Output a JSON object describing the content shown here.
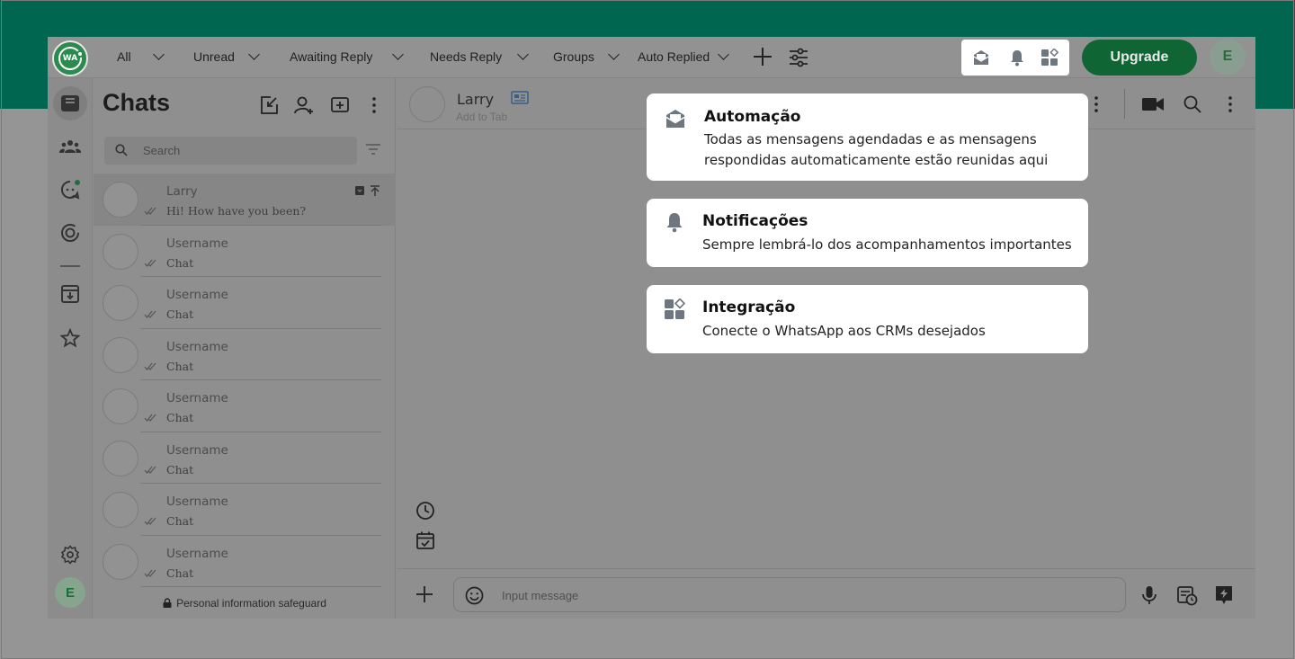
{
  "filter_tabs": [
    {
      "label": "All"
    },
    {
      "label": "Unread"
    },
    {
      "label": "Awaiting Reply"
    },
    {
      "label": "Needs Reply"
    },
    {
      "label": "Groups"
    },
    {
      "label": "Auto Replied"
    }
  ],
  "logo": {
    "text": "WA"
  },
  "upgrade_label": "Upgrade",
  "user_initial": "E",
  "chats": {
    "title": "Chats",
    "search_placeholder": "Search",
    "items": [
      {
        "name": "Larry",
        "message": "Hi! How have you been?"
      },
      {
        "name": "Username",
        "message": "Chat"
      },
      {
        "name": "Username",
        "message": "Chat"
      },
      {
        "name": "Username",
        "message": "Chat"
      },
      {
        "name": "Username",
        "message": "Chat"
      },
      {
        "name": "Username",
        "message": "Chat"
      },
      {
        "name": "Username",
        "message": "Chat"
      },
      {
        "name": "Username",
        "message": "Chat"
      }
    ],
    "safeguard_text": "Personal information safeguard"
  },
  "conversation": {
    "name": "Larry",
    "sub": "Add to Tab",
    "input_placeholder": "Input message"
  },
  "tooltips": [
    {
      "icon": "automation-inbox-icon",
      "title": "Automação",
      "description": "Todas as mensagens agendadas e as mensagens respondidas automaticamente estão reunidas aqui"
    },
    {
      "icon": "bell-icon",
      "title": "Notificações",
      "description": "Sempre lembrá-lo dos acompanhamentos importantes"
    },
    {
      "icon": "integration-icon",
      "title": "Integração",
      "description": "Conecte o WhatsApp aos CRMs desejados"
    }
  ],
  "colors": {
    "brand_green": "#00664f",
    "upgrade_green": "#0f6634",
    "overlay_gray": "#8f8f8f"
  }
}
